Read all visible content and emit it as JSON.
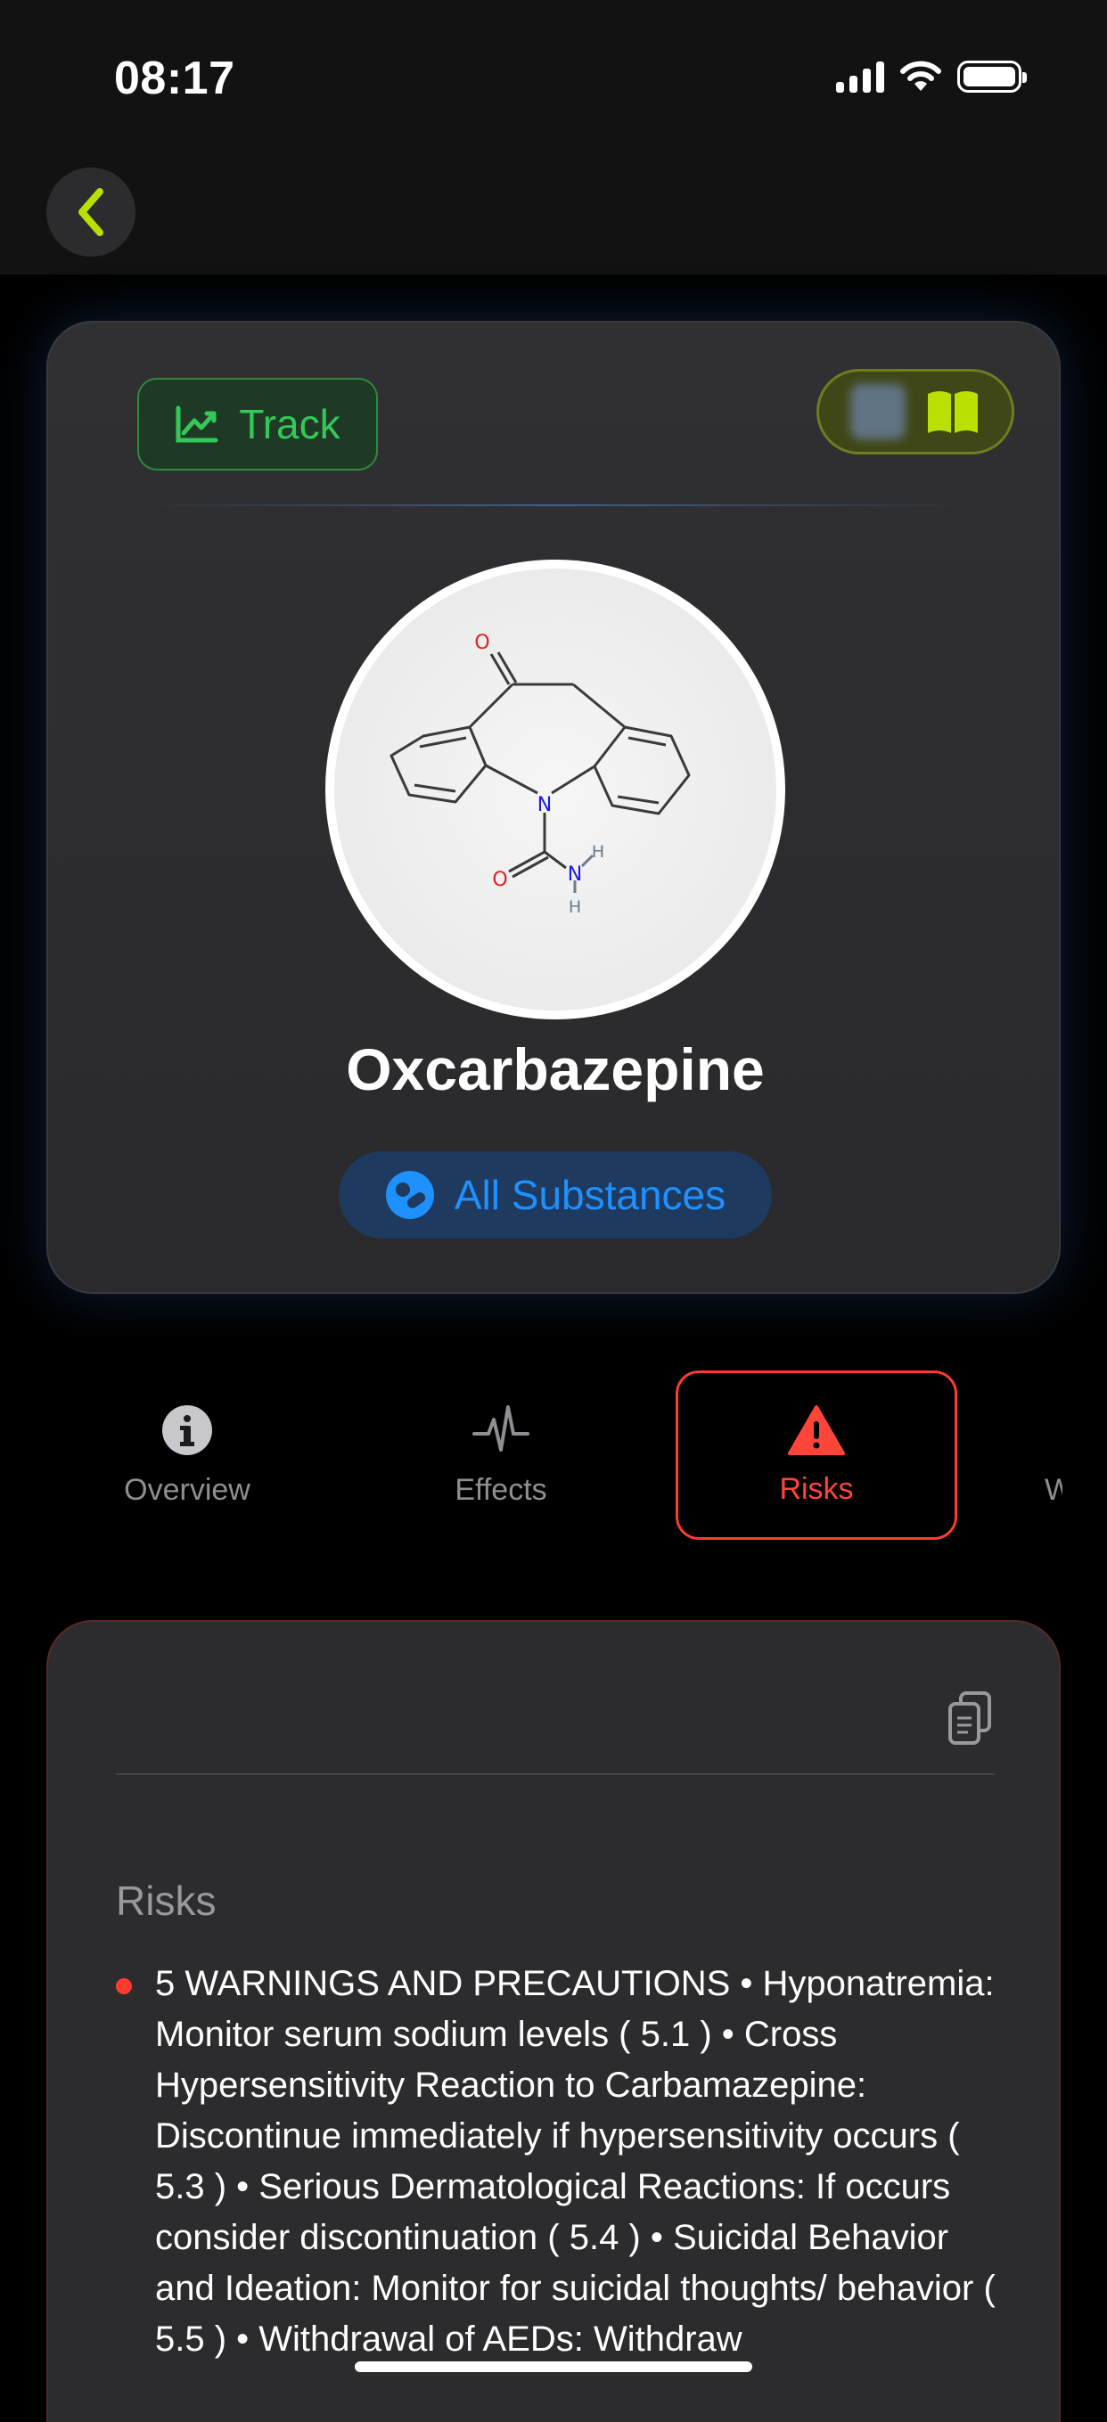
{
  "status_bar": {
    "time": "08:17"
  },
  "hero": {
    "track_label": "Track",
    "substance_name": "Oxcarbazepine",
    "all_substances_label": "All Substances",
    "molecule_atoms": {
      "oxygen_top": "O",
      "nitrogen_ring": "N",
      "oxygen_amide": "O",
      "nitrogen_amide": "N",
      "hydrogen_1": "H",
      "hydrogen_2": "H"
    }
  },
  "tabs": [
    {
      "label": "Overview",
      "icon": "info-circle-icon",
      "selected": false
    },
    {
      "label": "Effects",
      "icon": "waveform-icon",
      "selected": false
    },
    {
      "label": "Risks",
      "icon": "warning-triangle-icon",
      "selected": true
    },
    {
      "label": "W",
      "icon": "",
      "selected": false
    }
  ],
  "content": {
    "section_title": "Risks",
    "items": [
      "5 WARNINGS AND PRECAUTIONS • Hyponatremia: Monitor serum sodium levels ( 5.1 ) • Cross Hypersensitivity Reaction to Carbamazepine: Discontinue immediately if hypersensitivity occurs ( 5.3 ) • Serious Dermatological Reactions: If occurs consider discontinuation ( 5.4 ) • Suicidal Behavior and Ideation: Monitor for suicidal thoughts/ behavior ( 5.5 ) • Withdrawal of AEDs: Withdraw"
    ]
  },
  "colors": {
    "accent_green": "#34c759",
    "accent_lime": "#b8e000",
    "accent_blue": "#1e90ff",
    "risk_red": "#ff3b30",
    "background": "#000000"
  }
}
